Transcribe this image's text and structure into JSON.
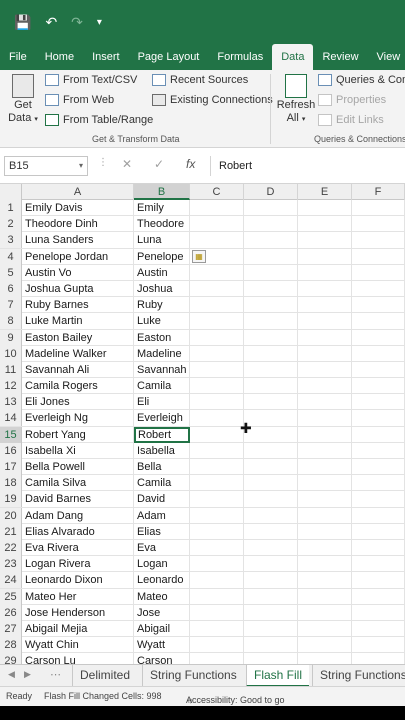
{
  "quick_access": {
    "save_icon": "save-icon",
    "undo_icon": "undo-icon",
    "redo_icon": "redo-icon",
    "customize_icon": "customize-icon"
  },
  "ribbon_tabs": [
    "File",
    "Home",
    "Insert",
    "Page Layout",
    "Formulas",
    "Data",
    "Review",
    "View"
  ],
  "active_tab": "Data",
  "ribbon": {
    "get_data_top": "Get",
    "get_data_bottom": "Data",
    "from_text_csv": "From Text/CSV",
    "from_web": "From Web",
    "from_table_range": "From Table/Range",
    "recent_sources": "Recent Sources",
    "existing_connections": "Existing Connections",
    "group_get_transform": "Get & Transform Data",
    "refresh_top": "Refresh",
    "refresh_bottom": "All",
    "queries_connections": "Queries & Conn",
    "properties": "Properties",
    "edit_links": "Edit Links",
    "group_queries": "Queries & Connections"
  },
  "formula_bar": {
    "name_box": "B15",
    "cancel": "✕",
    "enter": "✓",
    "fx": "fx",
    "value": "Robert"
  },
  "columns": [
    "A",
    "B",
    "C",
    "D",
    "E",
    "F"
  ],
  "selected_column": "B",
  "selected_row": 15,
  "rows": [
    {
      "num": "1",
      "a": "Emily Davis",
      "b": "Emily"
    },
    {
      "num": "2",
      "a": "Theodore Dinh",
      "b": "Theodore"
    },
    {
      "num": "3",
      "a": "Luna Sanders",
      "b": "Luna"
    },
    {
      "num": "4",
      "a": "Penelope Jordan",
      "b": "Penelope"
    },
    {
      "num": "5",
      "a": "Austin Vo",
      "b": "Austin"
    },
    {
      "num": "6",
      "a": "Joshua Gupta",
      "b": "Joshua"
    },
    {
      "num": "7",
      "a": "Ruby Barnes",
      "b": "Ruby"
    },
    {
      "num": "8",
      "a": "Luke Martin",
      "b": "Luke"
    },
    {
      "num": "9",
      "a": "Easton Bailey",
      "b": "Easton"
    },
    {
      "num": "10",
      "a": "Madeline Walker",
      "b": "Madeline"
    },
    {
      "num": "11",
      "a": "Savannah Ali",
      "b": "Savannah"
    },
    {
      "num": "12",
      "a": "Camila Rogers",
      "b": "Camila"
    },
    {
      "num": "13",
      "a": "Eli Jones",
      "b": "Eli"
    },
    {
      "num": "14",
      "a": "Everleigh Ng",
      "b": "Everleigh"
    },
    {
      "num": "15",
      "a": "Robert Yang",
      "b": "Robert"
    },
    {
      "num": "16",
      "a": "Isabella Xi",
      "b": "Isabella"
    },
    {
      "num": "17",
      "a": "Bella Powell",
      "b": "Bella"
    },
    {
      "num": "18",
      "a": "Camila Silva",
      "b": "Camila"
    },
    {
      "num": "19",
      "a": "David Barnes",
      "b": "David"
    },
    {
      "num": "20",
      "a": "Adam Dang",
      "b": "Adam"
    },
    {
      "num": "21",
      "a": "Elias Alvarado",
      "b": "Elias"
    },
    {
      "num": "22",
      "a": "Eva Rivera",
      "b": "Eva"
    },
    {
      "num": "23",
      "a": "Logan Rivera",
      "b": "Logan"
    },
    {
      "num": "24",
      "a": "Leonardo Dixon",
      "b": "Leonardo"
    },
    {
      "num": "25",
      "a": "Mateo Her",
      "b": "Mateo"
    },
    {
      "num": "26",
      "a": "Jose Henderson",
      "b": "Jose"
    },
    {
      "num": "27",
      "a": "Abigail Mejia",
      "b": "Abigail"
    },
    {
      "num": "28",
      "a": "Wyatt Chin",
      "b": "Wyatt"
    },
    {
      "num": "29",
      "a": "Carson Lu",
      "b": "Carson"
    }
  ],
  "sheet_tabs": [
    "Delimited",
    "String Functions",
    "Flash Fill",
    "String Functions"
  ],
  "active_sheet": "Flash Fill",
  "status": {
    "ready": "Ready",
    "flash_fill": "Flash Fill Changed Cells: 998",
    "accessibility": "Accessibility: Good to go"
  },
  "colors": {
    "accent": "#217346"
  }
}
